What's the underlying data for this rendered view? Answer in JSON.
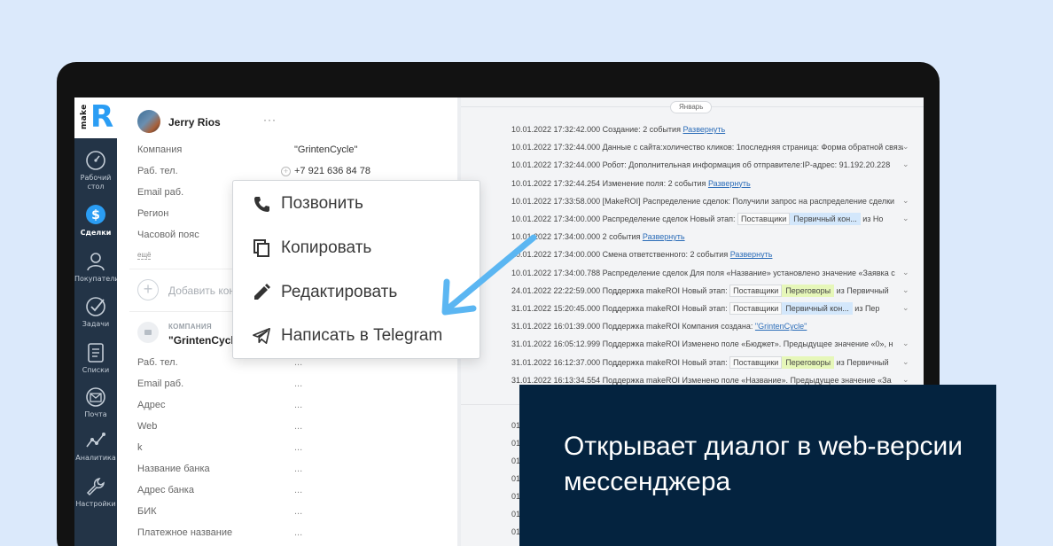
{
  "logo": {
    "make": "make",
    "r": "R"
  },
  "sidebar": {
    "items": [
      {
        "label1": "Рабочий",
        "label2": "стол",
        "icon": "speedometer-icon"
      },
      {
        "label1": "Сделки",
        "label2": "",
        "icon": "dollar-icon",
        "active": true
      },
      {
        "label1": "Покупатели",
        "label2": "",
        "icon": "users-icon"
      },
      {
        "label1": "Задачи",
        "label2": "",
        "icon": "check-icon"
      },
      {
        "label1": "Списки",
        "label2": "",
        "icon": "list-icon"
      },
      {
        "label1": "Почта",
        "label2": "",
        "icon": "mail-icon"
      },
      {
        "label1": "Аналитика",
        "label2": "",
        "icon": "analytics-icon"
      },
      {
        "label1": "Настройки",
        "label2": "",
        "icon": "wrench-icon"
      }
    ]
  },
  "contact": {
    "name": "Jerry Rios",
    "dots": "···",
    "fields": [
      {
        "label": "Компания",
        "value": "\"GrintenCycle\""
      },
      {
        "label": "Раб. тел.",
        "value": "+7 921 636 84 78"
      },
      {
        "label": "Email раб.",
        "value": ""
      },
      {
        "label": "Регион",
        "value": ""
      },
      {
        "label": "Часовой пояс",
        "value": ""
      }
    ],
    "more": "ещё",
    "add_contact": "Добавить контакт"
  },
  "company": {
    "small_label": "КОМПАНИЯ",
    "name": "\"GrintenCycle\"",
    "fields": [
      {
        "label": "Раб. тел.",
        "value": "..."
      },
      {
        "label": "Email раб.",
        "value": "..."
      },
      {
        "label": "Адрес",
        "value": "..."
      },
      {
        "label": "Web",
        "value": "..."
      },
      {
        "label": "k",
        "value": "..."
      },
      {
        "label": "Название банка",
        "value": "..."
      },
      {
        "label": "Адрес банка",
        "value": "..."
      },
      {
        "label": "БИК",
        "value": "..."
      },
      {
        "label": "Платежное название",
        "value": "..."
      }
    ]
  },
  "popup": {
    "items": [
      {
        "label": "Позвонить",
        "icon": "phone-icon"
      },
      {
        "label": "Копировать",
        "icon": "copy-icon"
      },
      {
        "label": "Редактировать",
        "icon": "pencil-icon"
      },
      {
        "label": "Написать в Telegram",
        "icon": "telegram-icon"
      }
    ]
  },
  "timeline": {
    "month": "Январь",
    "rows": [
      {
        "text": "10.01.2022 17:32:42.000 Создание: 2 события ",
        "link": "Развернуть",
        "chev": false
      },
      {
        "text": "10.01.2022 17:32:44.000 Данные с сайта:холичество кликов: 1последняя страница: Форма обратной связи",
        "link": "",
        "chev": true
      },
      {
        "text": "10.01.2022 17:32:44.000 Робот: Дополнительная информация об отправителе:IP-адрес: 91.192.20.228",
        "link": "",
        "chev": true
      },
      {
        "text": "10.01.2022 17:32:44.254 Изменение поля: 2 события ",
        "link": "Развернуть",
        "chev": false
      },
      {
        "text": "10.01.2022 17:33:58.000 [MakeROI] Распределение сделок: Получили запрос на распределение сделки",
        "link": "",
        "chev": true
      },
      {
        "text": "10.01.2022 17:34:00.000 Распределение сделок Новый этап: ",
        "tag1": "Поставщики",
        "tag2": "Первичный кон...",
        "tag2color": "blue",
        "after": " из Но",
        "chev": true
      },
      {
        "text": "10.01.2022 17:34:00.000 2 события ",
        "link": "Развернуть",
        "chev": false
      },
      {
        "text": "10.01.2022 17:34:00.000 Смена ответственного: 2 события ",
        "link": "Развернуть",
        "chev": false
      },
      {
        "text": "10.01.2022 17:34:00.788 Распределение сделок Для поля «Название» установлено значение «Заявка с",
        "link": "",
        "chev": true
      },
      {
        "text": "24.01.2022 22:22:59.000 Поддержка makeROI Новый этап: ",
        "tag1": "Поставщики",
        "tag2": "Переговоры",
        "tag2color": "green",
        "after": " из Первичный",
        "chev": true
      },
      {
        "text": "31.01.2022 15:20:45.000 Поддержка makeROI Новый этап: ",
        "tag1": "Поставщики",
        "tag2": "Первичный кон...",
        "tag2color": "blue",
        "after": " из Пер",
        "chev": true
      },
      {
        "text": "31.01.2022 16:01:39.000 Поддержка makeROI Компания создана: ",
        "link": "\"GrintenCycle\"",
        "chev": false
      },
      {
        "text": "31.01.2022 16:05:12.999 Поддержка makeROI Изменено поле «Бюджет». Предыдущее значение «0», н",
        "link": "",
        "chev": true
      },
      {
        "text": "31.01.2022 16:12:37.000 Поддержка makeROI Новый этап: ",
        "tag1": "Поставщики",
        "tag2": "Переговоры",
        "tag2color": "green",
        "after": " из Первичный",
        "chev": true
      },
      {
        "text": "31.01.2022 16:13:34.554 Поддержка makeROI Изменено поле «Название». Предыдущее значение «За",
        "link": "",
        "chev": true
      }
    ],
    "stubs": [
      "01",
      "01",
      "01",
      "01",
      "01",
      "01",
      "01"
    ]
  },
  "callout": {
    "text": "Открывает диалог в web-версии мессенджера"
  },
  "colors": {
    "accent": "#2a9df4",
    "sidebar": "#233447",
    "callout": "#04233f",
    "arrow": "#5bb6f2"
  }
}
